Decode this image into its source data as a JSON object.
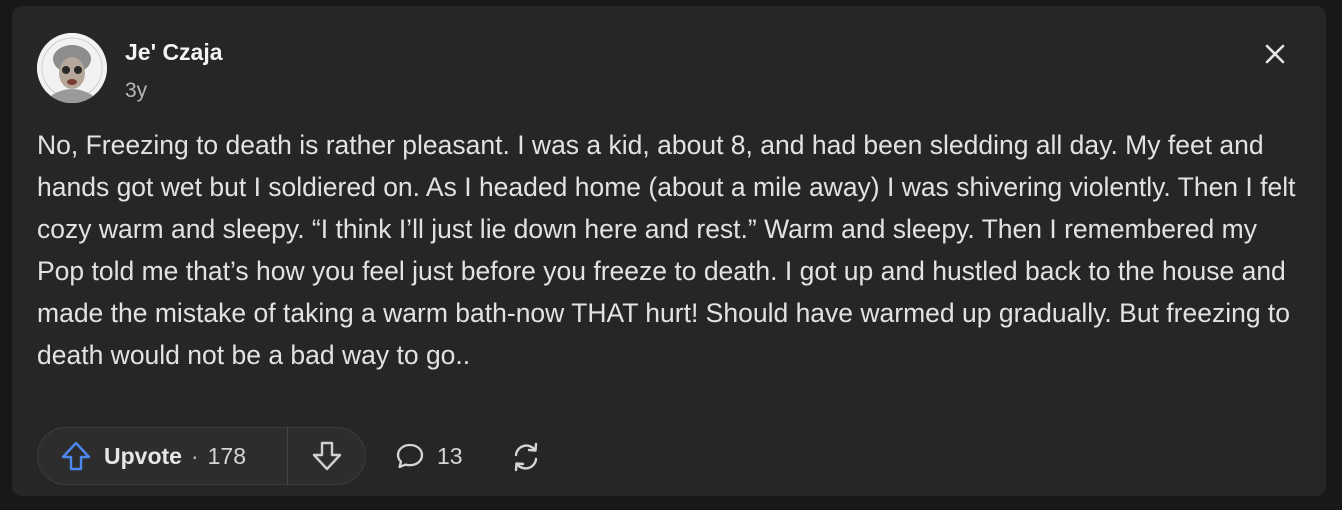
{
  "post": {
    "author": "Je' Czaja",
    "age": "3y",
    "body": "No, Freezing to death is rather pleasant. I was a kid, about 8, and had been sledding all day. My feet and hands got wet but I soldiered on. As I headed home (about a mile away) I was shivering violently. Then I felt cozy warm and sleepy. “I think I’ll just lie down here and rest.” Warm and sleepy. Then I remembered my Pop told me that’s how you feel just before you freeze to death. I got up and hustled back to the house and made the mistake of taking a warm bath-now THAT hurt! Should have warmed up gradually. But freezing to death would not be a bad way to go.."
  },
  "actions": {
    "upvote_label": "Upvote",
    "separator": "·",
    "upvote_count": "178",
    "comment_count": "13"
  },
  "icons": {
    "close": "close-icon",
    "upvote": "arrow-up-icon",
    "downvote": "arrow-down-icon",
    "comment": "comment-icon",
    "share": "repost-icon"
  },
  "colors": {
    "background": "#181818",
    "card": "#262626",
    "upvote_accent": "#4b87ee",
    "text": "#e2e2e2"
  }
}
